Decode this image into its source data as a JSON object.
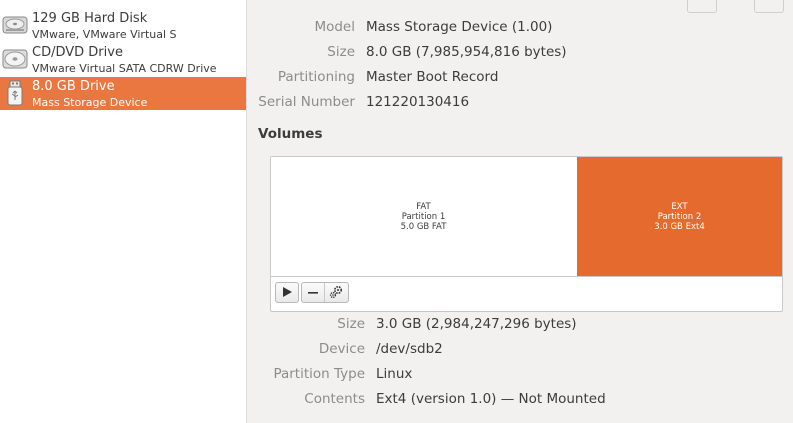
{
  "sidebar": {
    "drives": [
      {
        "name": "129 GB Hard Disk",
        "subtitle": "VMware, VMware Virtual S",
        "icon": "hard-disk-icon"
      },
      {
        "name": "CD/DVD Drive",
        "subtitle": "VMware Virtual SATA CDRW Drive",
        "icon": "optical-drive-icon"
      },
      {
        "name": "8.0 GB Drive",
        "subtitle": "Mass Storage Device",
        "icon": "usb-drive-icon",
        "selected": true
      }
    ]
  },
  "drive_details": {
    "model_label": "Model",
    "model_value": "Mass Storage Device (1.00)",
    "size_label": "Size",
    "size_value": "8.0 GB (7,985,954,816 bytes)",
    "partitioning_label": "Partitioning",
    "partitioning_value": "Master Boot Record",
    "serial_label": "Serial Number",
    "serial_value": "121220130416"
  },
  "volumes": {
    "heading": "Volumes",
    "partitions": [
      {
        "type": "FAT",
        "name": "Partition 1",
        "desc": "5.0 GB FAT"
      },
      {
        "type": "EXT",
        "name": "Partition 2",
        "desc": "3.0 GB Ext4",
        "selected": true
      }
    ],
    "toolbar": {
      "play_icon": "play-icon",
      "remove_icon": "minus-icon",
      "settings_icon": "gears-icon"
    }
  },
  "volume_details": {
    "size_label": "Size",
    "size_value": "3.0 GB (2,984,247,296 bytes)",
    "device_label": "Device",
    "device_value": "/dev/sdb2",
    "partition_type_label": "Partition Type",
    "partition_type_value": "Linux",
    "contents_label": "Contents",
    "contents_value": "Ext4 (version 1.0) — Not Mounted"
  },
  "colors": {
    "accent": "#e9773f",
    "partition_selected": "#e56a2e",
    "label": "#8c8c8c",
    "text": "#3c3c3c"
  }
}
